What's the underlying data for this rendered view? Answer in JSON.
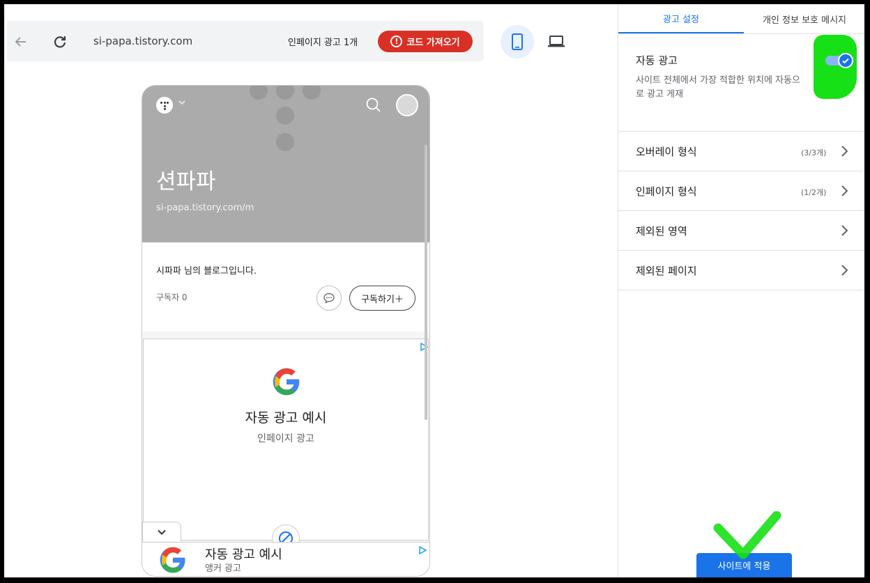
{
  "topbar": {
    "url": "si-papa.tistory.com",
    "inpage_count": "인페이지 광고 1개",
    "code_button": "코드 가져오기"
  },
  "phone": {
    "blog_title": "션파파",
    "blog_url": "si-papa.tistory.com/m",
    "description": "시파파 님의 블로그입니다.",
    "subscribers": "구독자 0",
    "subscribe_button": "구독하기＋",
    "inpage_ad": {
      "title": "자동 광고 예시",
      "subtitle": "인페이지 광고"
    },
    "anchor_ad": {
      "title": "자동 광고 예시",
      "subtitle": "앵커 광고"
    }
  },
  "panel": {
    "tabs": [
      {
        "label": "광고 설정",
        "active": true
      },
      {
        "label": "개인 정보 보호 메시지",
        "active": false
      }
    ],
    "auto_ads": {
      "title": "자동 광고",
      "description": "사이트 전체에서 가장 적합한 위치에 자동으로 광고 게재",
      "enabled": true
    },
    "rows": [
      {
        "label": "오버레이 형식",
        "count": "(3/3개)"
      },
      {
        "label": "인페이지 형식",
        "count": "(1/2개)"
      },
      {
        "label": "제외된 영역",
        "count": ""
      },
      {
        "label": "제외된 페이지",
        "count": ""
      }
    ],
    "apply_button": "사이트에 적용"
  },
  "colors": {
    "accent": "#1a73e8",
    "danger": "#d93025",
    "annotation_green": "#16e016"
  },
  "icons": [
    "back-arrow-icon",
    "reload-icon",
    "warning-icon",
    "phone-icon",
    "laptop-icon",
    "search-icon",
    "chevron-right-icon",
    "checkmark-icon"
  ]
}
